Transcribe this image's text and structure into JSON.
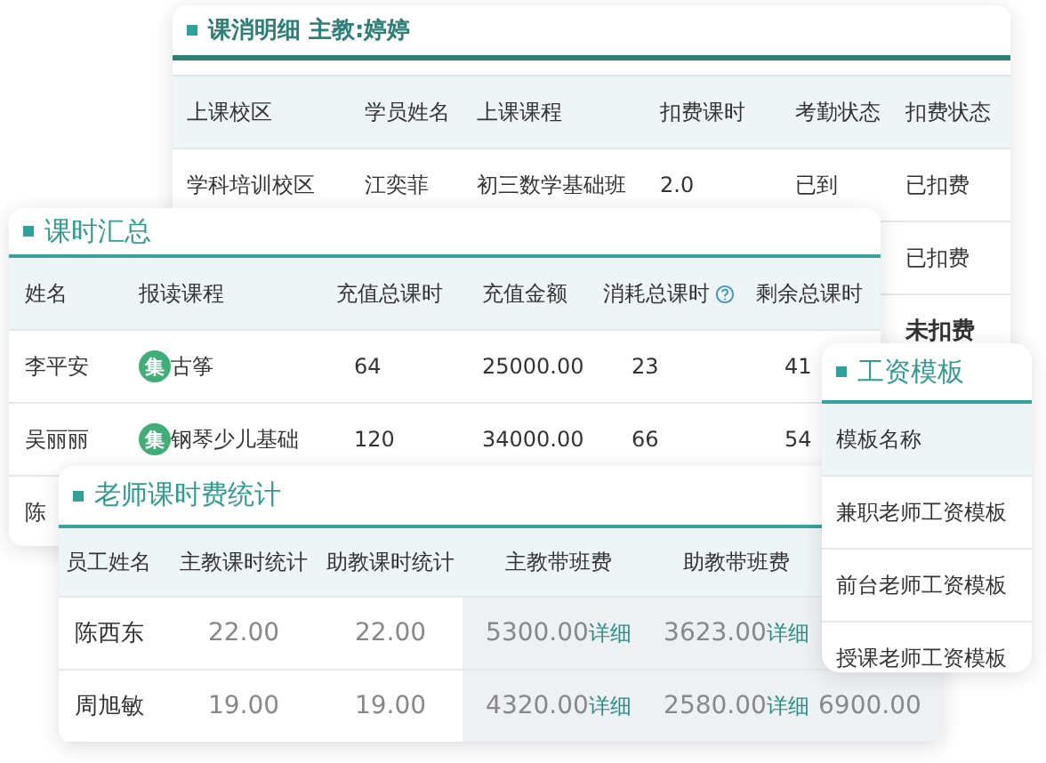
{
  "lesson_detail": {
    "title": "课消明细 主教:婷婷",
    "columns": [
      "上课校区",
      "学员姓名",
      "上课课程",
      "扣费课时",
      "考勤状态",
      "扣费状态"
    ],
    "rows": [
      {
        "cells": [
          "学科培训校区",
          "江奕菲",
          "初三数学基础班",
          "2.0",
          "已到",
          "已扣费"
        ]
      },
      {
        "cells": [
          null,
          null,
          null,
          null,
          null,
          "已扣费"
        ]
      },
      {
        "cells": [
          null,
          null,
          null,
          null,
          null,
          "未扣费"
        ]
      }
    ]
  },
  "hours_summary": {
    "title": "课时汇总",
    "columns": [
      {
        "label": "姓名"
      },
      {
        "label": "报读课程"
      },
      {
        "label": "充值总课时"
      },
      {
        "label": "充值金额"
      },
      {
        "label": "消耗总课时",
        "help": true
      },
      {
        "label": "剩余总课时"
      }
    ],
    "rows": [
      {
        "name": "李平安",
        "badge": "集",
        "course": "古筝",
        "recharge_hours": "64",
        "amount": "25000.00",
        "used": "23",
        "remaining": "41"
      },
      {
        "name": "吴丽丽",
        "badge": "集",
        "course": "钢琴少儿基础",
        "recharge_hours": "120",
        "amount": "34000.00",
        "used": "66",
        "remaining": "54"
      },
      {
        "name": "陈"
      }
    ]
  },
  "teacher_fees": {
    "title": "老师课时费统计",
    "columns": [
      "员工姓名",
      "主教课时统计",
      "助教课时统计",
      "主教带班费",
      "助教带班费"
    ],
    "rows": [
      {
        "name": "陈西东",
        "main_hours": "22.00",
        "assist_hours": "22.00",
        "main_fee": "5300.00",
        "main_link": "详细",
        "assist_fee": "3623.00",
        "assist_link": "详细"
      },
      {
        "name": "周旭敏",
        "main_hours": "19.00",
        "assist_hours": "19.00",
        "main_fee": "4320.00",
        "main_link": "详细",
        "assist_fee": "2580.00",
        "assist_link": "详细",
        "column_6": "6900.00"
      }
    ]
  },
  "salary_templates": {
    "title": "工资模板",
    "column": "模板名称",
    "rows": [
      "兼职老师工资模板",
      "前台老师工资模板",
      "授课老师工资模板"
    ]
  }
}
